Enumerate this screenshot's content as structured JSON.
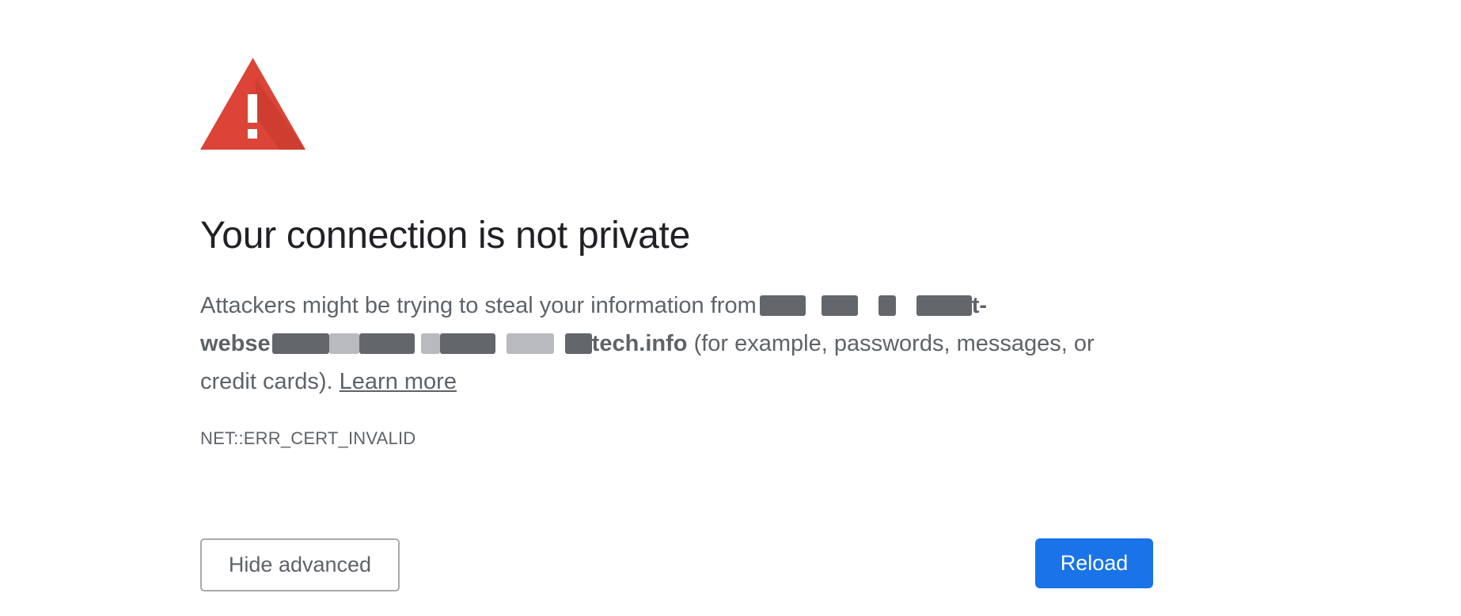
{
  "interstitial": {
    "icon": "warning-triangle-icon",
    "icon_color": "#db4437",
    "title": "Your connection is not private",
    "message_prefix": "Attackers might be trying to steal your information from",
    "host_visible_fragment_1": "t-",
    "host_visible_fragment_2": "webse",
    "host_visible_fragment_3": "tech.info",
    "message_suffix": " (for example, passwords, messages, or credit cards). ",
    "learn_more_label": "Learn more",
    "error_code": "NET::ERR_CERT_INVALID"
  },
  "buttons": {
    "hide_advanced_label": "Hide advanced",
    "reload_label": "Reload",
    "primary_color": "#1a73e8"
  }
}
